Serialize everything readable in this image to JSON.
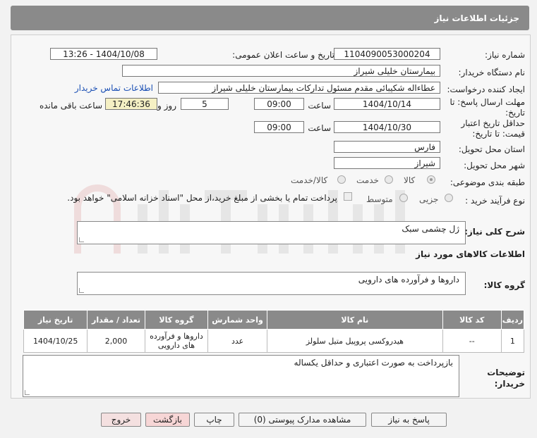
{
  "header": {
    "title": "جزئیات اطلاعات نیاز"
  },
  "fields": {
    "need_number_label": "شماره نیاز:",
    "need_number": "1104090053000204",
    "announce_label": "تاریخ و ساعت اعلان عمومی:",
    "announce_value": "1404/10/08 - 13:26",
    "buyer_org_label": "نام دستگاه خریدار:",
    "buyer_org": "بیمارستان خلیلی شیراز",
    "creator_label": "ایجاد کننده درخواست:",
    "creator": "عطاءاله شکیبائی مقدم مسئول تدارکات  بیمارستان خلیلی شیراز",
    "contact_link": "اطلاعات تماس خریدار",
    "deadline_label": "مهلت ارسال پاسخ: تا تاریخ:",
    "deadline_date": "1404/10/14",
    "time_label": "ساعت",
    "deadline_time": "09:00",
    "days_value": "5",
    "days_and": "روز و",
    "remaining_time": "17:46:36",
    "remaining_label": "ساعت باقی مانده",
    "validity_label": "حداقل تاریخ اعتبار قیمت: تا تاریخ:",
    "validity_date": "1404/10/30",
    "validity_time": "09:00",
    "province_label": "استان محل تحویل:",
    "province": "فارس",
    "city_label": "شهر محل تحویل:",
    "city": "شیراز",
    "category_label": "طبقه بندی موضوعی:",
    "category_options": [
      "کالا",
      "خدمت",
      "کالا/خدمت"
    ],
    "process_label": "نوع فرآیند خرید :",
    "process_options": [
      "جزیی",
      "متوسط"
    ],
    "payment_note": "پرداخت تمام یا بخشی از مبلغ خرید،از محل \"اسناد خزانه اسلامی\" خواهد بود."
  },
  "summary": {
    "label": "شرح کلی نیاز:",
    "value": "ژل چشمی سبک"
  },
  "goods": {
    "section_title": "اطلاعات کالاهای مورد نیاز",
    "group_label": "گروه کالا:",
    "group_value": "داروها و فرآورده های دارویی"
  },
  "table": {
    "headers": [
      "ردیف",
      "کد کالا",
      "نام کالا",
      "واحد شمارش",
      "گروه کالا",
      "تعداد / مقدار",
      "تاریخ نیاز"
    ],
    "rows": [
      [
        "1",
        "--",
        "هیدروکسی پروپیل متیل سلولز",
        "عدد",
        "داروها و فرآورده های دارویی",
        "2,000",
        "1404/10/25"
      ]
    ]
  },
  "notes": {
    "label": "توضیحات خریدار:",
    "value": "بازپرداخت به صورت اعتباری و حداقل یکساله"
  },
  "buttons": {
    "reply": "پاسخ به نیاز",
    "docs": "مشاهده مدارک پیوستی (0)",
    "print": "چاپ",
    "back": "بازگشت",
    "exit": "خروج"
  },
  "colors": {
    "header_bg": "#8a8a8a",
    "link": "#1a4fb4",
    "highlight": "#f5f0c4"
  }
}
